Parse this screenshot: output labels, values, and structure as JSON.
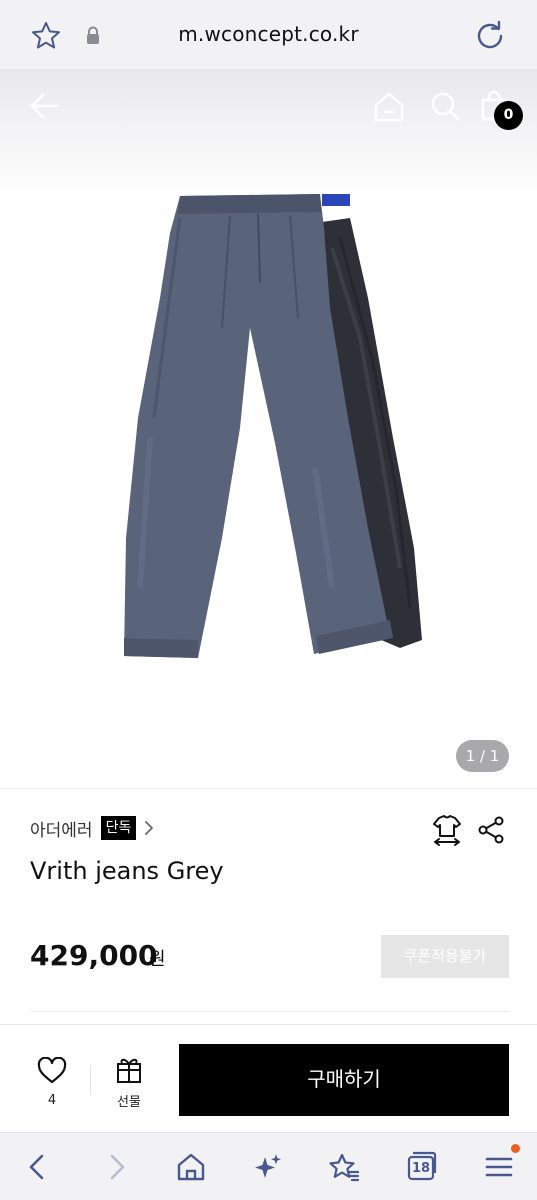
{
  "browser": {
    "url": "m.wconcept.co.kr",
    "icons": [
      "bookmark-star-icon",
      "lock-icon",
      "reload-icon"
    ]
  },
  "header": {
    "icons": [
      "back-arrow-icon",
      "home-icon",
      "search-icon",
      "shopping-bag-icon"
    ],
    "cart_count": "0"
  },
  "gallery": {
    "pager": "1 / 1",
    "image_subject": "jeans"
  },
  "product": {
    "brand": "아더에러",
    "badge": "단독",
    "name": "Vrith jeans Grey",
    "price": "429,000",
    "currency": "원",
    "coupon_label": "쿠폰적용불가"
  },
  "actions": {
    "like_count": "4",
    "gift_label": "선물",
    "buy_label": "구매하기"
  },
  "browser_nav": {
    "tab_count": "18",
    "icons": [
      "back-icon",
      "forward-icon",
      "home-icon",
      "sparkles-icon",
      "favorites-star-icon",
      "tabs-icon",
      "menu-icon"
    ]
  },
  "colors": {
    "accent": "#000000",
    "notification_dot": "#ef5b23",
    "coupon_disabled_bg": "#e6e6e6",
    "denim_light": "#59637a",
    "denim_dark": "#2e3038"
  }
}
